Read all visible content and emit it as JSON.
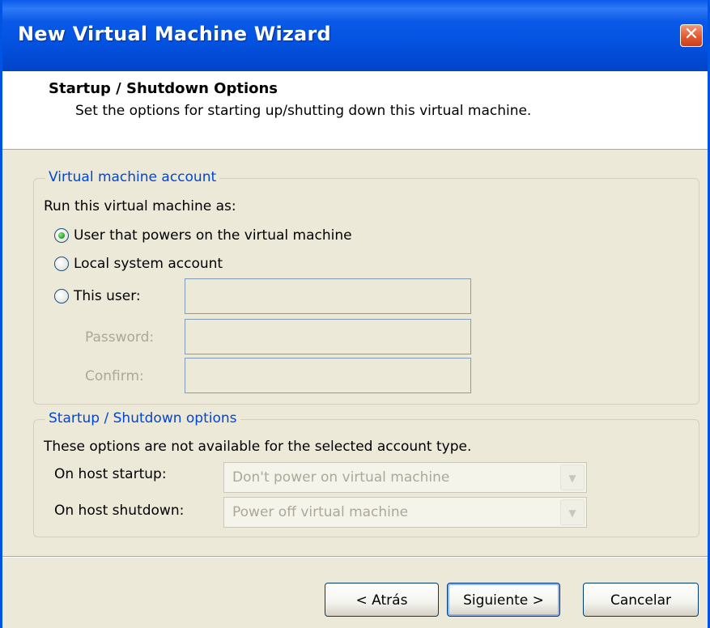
{
  "window": {
    "title": "New Virtual Machine Wizard",
    "close_glyph": "✕"
  },
  "header": {
    "title": "Startup / Shutdown Options",
    "subtitle": "Set the options for starting up/shutting down this virtual machine."
  },
  "account_group": {
    "legend": "Virtual machine account",
    "prompt": "Run this virtual machine as:",
    "options": [
      {
        "label": "User that powers on the virtual machine",
        "checked": true
      },
      {
        "label": "Local system account",
        "checked": false
      },
      {
        "label": "This user:",
        "checked": false
      }
    ],
    "user_field": {
      "value": ""
    },
    "password_label": "Password:",
    "password_field": {
      "value": ""
    },
    "confirm_label": "Confirm:",
    "confirm_field": {
      "value": ""
    }
  },
  "startup_group": {
    "legend": "Startup / Shutdown options",
    "note": "These options are not available for the selected account type.",
    "host_startup_label": "On host startup:",
    "host_startup_value": "Don't power on virtual machine",
    "host_shutdown_label": "On host shutdown:",
    "host_shutdown_value": "Power off virtual machine"
  },
  "buttons": {
    "back": "< Atrás",
    "next": "Siguiente >",
    "cancel": "Cancelar"
  },
  "colors": {
    "titlebar": "#0054E3",
    "legend": "#0046D5",
    "disabled_text": "#ACA899"
  }
}
